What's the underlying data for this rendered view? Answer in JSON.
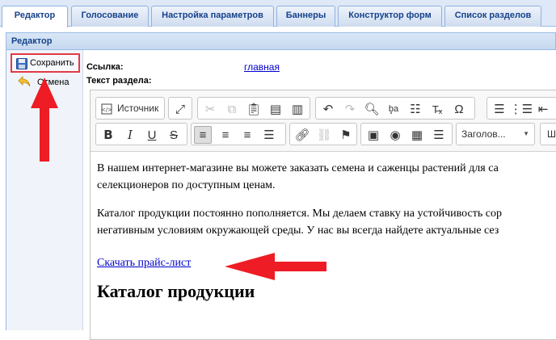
{
  "tabs": [
    {
      "label": "Редактор",
      "active": true
    },
    {
      "label": "Голосование"
    },
    {
      "label": "Настройка параметров"
    },
    {
      "label": "Баннеры"
    },
    {
      "label": "Конструктор форм"
    },
    {
      "label": "Список разделов"
    }
  ],
  "panel": {
    "title": "Редактор"
  },
  "actions": {
    "save_label": "Сохранить",
    "cancel_label": "Отмена"
  },
  "form": {
    "link_label": "Ссылка:",
    "link_value": "главная",
    "section_text_label": "Текст раздела:"
  },
  "editor": {
    "source_label": "Источник",
    "format_label": "Заголов...",
    "cut_off_label": "Ш",
    "content": {
      "p1_line1": "В нашем интернет-магазине вы можете заказать семена и саженцы растений для са",
      "p1_line2": "селекционеров по доступным ценам.",
      "p2_line1": "Каталог продукции постоянно пополняется. Мы делаем ставку на устойчивость сор",
      "p2_line2": "негативным условиям окружающей среды. У нас вы всегда найдете актуальные сез",
      "download_link": "Скачать прайс-лист",
      "heading": "Каталог продукции"
    }
  },
  "colors": {
    "annotation_arrow": "#ee1c25",
    "tab_text": "#15428b",
    "link": "#0000cc"
  }
}
